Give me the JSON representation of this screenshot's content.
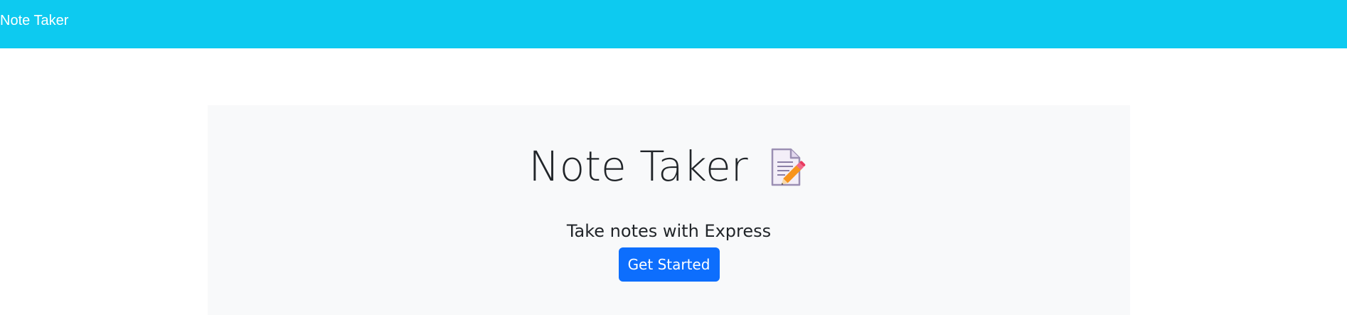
{
  "navbar": {
    "brand": "Note Taker",
    "background_color": "#0dcaf0"
  },
  "hero": {
    "title": "Note Taker",
    "title_icon": "memo-icon",
    "subtitle": "Take notes with Express",
    "cta_label": "Get Started",
    "background_color": "#f8f9fa",
    "cta_color": "#0d6efd"
  }
}
